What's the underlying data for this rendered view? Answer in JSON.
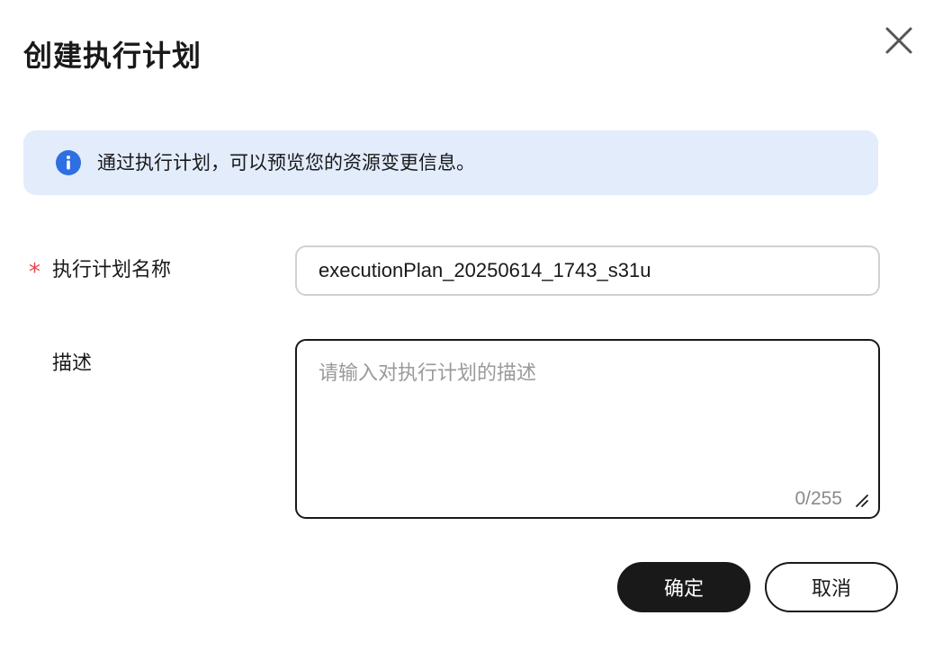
{
  "dialog": {
    "title": "创建执行计划",
    "close_icon": "close-icon"
  },
  "alert": {
    "icon": "info-icon",
    "text": "通过执行计划，可以预览您的资源变更信息。",
    "background": "#e3ecfb",
    "icon_color": "#2f6fe4"
  },
  "form": {
    "name": {
      "required_mark": "*",
      "label": "执行计划名称",
      "value": "executionPlan_20250614_1743_s31u"
    },
    "description": {
      "label": "描述",
      "placeholder": "请输入对执行计划的描述",
      "value": "",
      "counter": "0/255"
    }
  },
  "footer": {
    "confirm_label": "确定",
    "cancel_label": "取消"
  },
  "colors": {
    "primary": "#191919",
    "required": "#e2484a"
  }
}
